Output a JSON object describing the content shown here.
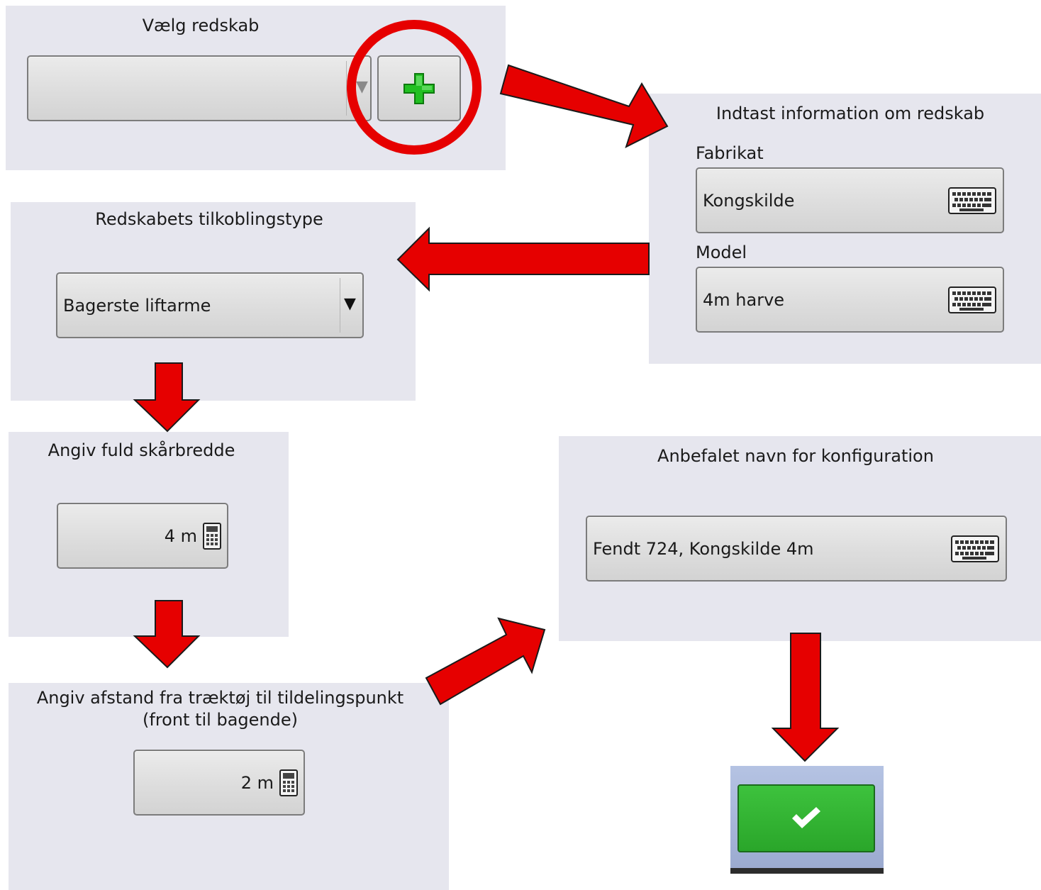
{
  "select_implement": {
    "title": "Vælg redskab",
    "dropdown_value": ""
  },
  "implement_info": {
    "title": "Indtast information om redskab",
    "make_label": "Fabrikat",
    "make_value": "Kongskilde",
    "model_label": "Model",
    "model_value": "4m harve"
  },
  "hitch_type": {
    "title": "Redskabets tilkoblingstype",
    "value": "Bagerste liftarme"
  },
  "working_width": {
    "title": "Angiv fuld skårbredde",
    "value": "4 m"
  },
  "hitch_distance": {
    "title_line1": "Angiv afstand fra træktøj til tildelingspunkt",
    "title_line2": "(front til bagende)",
    "value": "2 m"
  },
  "config_name": {
    "title": "Anbefalet navn for konfiguration",
    "value": "Fendt 724, Kongskilde 4m"
  },
  "colors": {
    "panel_bg": "#e6e6ee",
    "arrow_red": "#e60000",
    "confirm_green": "#2fb12f",
    "add_icon_green": "#22c022"
  },
  "icons": {
    "add": "plus-icon",
    "keyboard": "keyboard-icon",
    "calculator": "calculator-icon",
    "confirm": "checkmark-icon",
    "dropdown": "dropdown-arrow-icon"
  }
}
